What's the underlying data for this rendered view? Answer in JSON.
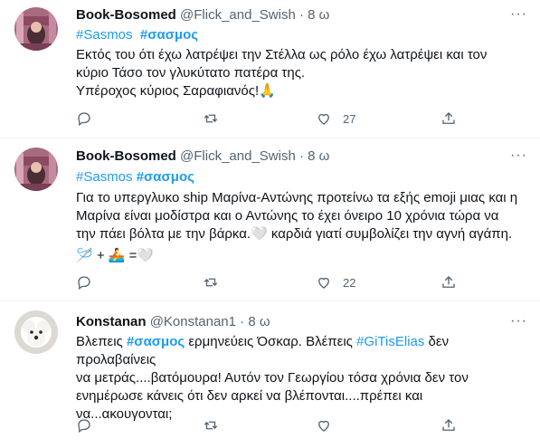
{
  "tweets": [
    {
      "name": "Book-Bosomed",
      "handle": "@Flick_and_Swish",
      "time": "8 ω",
      "tag1": "#Sasmos",
      "tag2": "#σασμος",
      "line1": "Εκτός του ότι έχω λατρέψει την Στέλλα ως ρόλο έχω λατρέψει και τον",
      "line2": "κύριο Τάσο τον γλυκύτατο πατέρα της.",
      "line3": "Υπέροχος κύριος Σαραφιανός!🙏",
      "replies": "",
      "retweets": "",
      "likes": "27"
    },
    {
      "name": "Book-Bosomed",
      "handle": "@Flick_and_Swish",
      "time": "8 ω",
      "tag1": "#Sasmos",
      "tag2": "#σασμος",
      "line1": "Για το υπεργλυκο ship Μαρίνα-Αντώνης προτείνω τα εξής emoji μιας και η",
      "line2": "Μαρίνα είναι μοδίστρα και ο Αντώνης το έχει όνειρο 10 χρόνια τώρα να",
      "line3": "την πάει βόλτα με την βάρκα.🤍 καρδιά γιατί συμβολίζει την αγνή αγάπη.",
      "line4": "🪡 + 🚣 =🤍",
      "replies": "",
      "retweets": "",
      "likes": "22"
    },
    {
      "name": "Konstanan",
      "handle": "@Konstanan1",
      "time": "8 ω",
      "text1a": "Βλεπεις ",
      "link1": "#σασμος",
      "text1b": " ερμηνεύεις Όσκαρ. Βλέπεις ",
      "link2": "#GiTisElias",
      "text1c": " δεν προλαβαίνεις",
      "line2": "να μετράς....βατόμουρα! Αυτόν τον Γεωργίου τόσα χρόνια δεν τον",
      "line3": "ενημέρωσε κάνεις ότι δεν αρκεί να βλέπονται....πρέπει και",
      "line4": "να...ακουγονται;",
      "replies": "",
      "retweets": "",
      "likes": ""
    }
  ],
  "colors": {
    "accent": "#1d9bf0",
    "secondary_text": "#536471",
    "divider": "#eff3f4"
  },
  "icons": [
    "more-icon",
    "reply-icon",
    "retweet-icon",
    "like-icon",
    "share-icon"
  ]
}
